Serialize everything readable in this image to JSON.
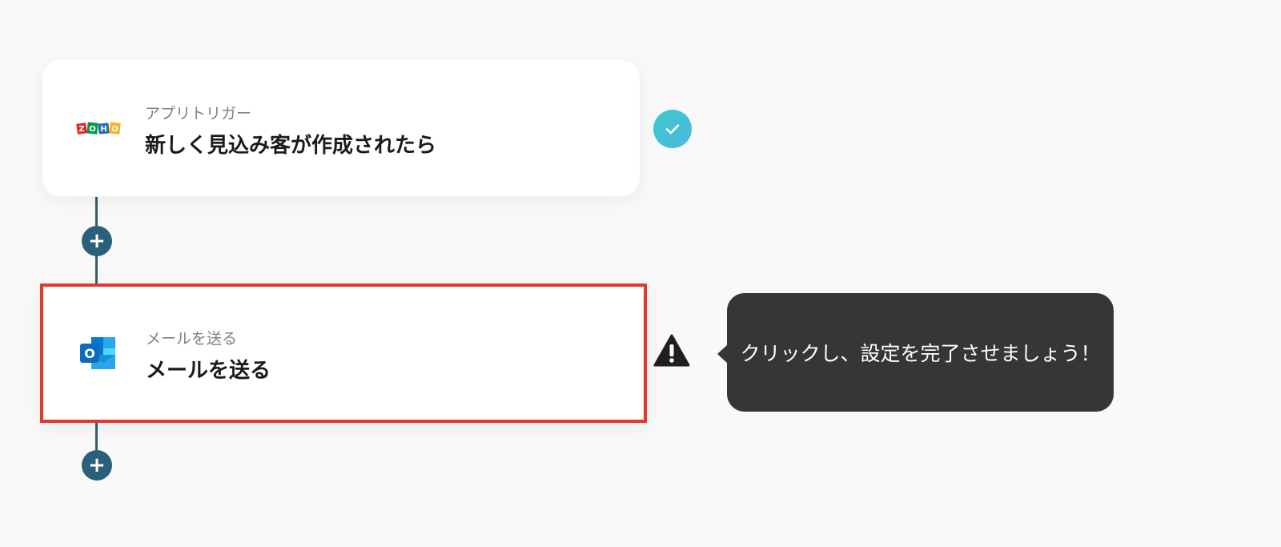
{
  "flow": {
    "steps": [
      {
        "type_label": "アプリトリガー",
        "title": "新しく見込み客が作成されたら",
        "app_icon": "zoho-logo-icon",
        "status": "complete",
        "status_icon": "check-icon"
      },
      {
        "type_label": "メールを送る",
        "title": "メールを送る",
        "app_icon": "outlook-logo-icon",
        "status": "incomplete",
        "status_icon": "warning-icon",
        "highlighted": true
      }
    ],
    "add_step_label": "+"
  },
  "tooltip": {
    "text": "クリックし、設定を完了させましょう！"
  },
  "colors": {
    "background": "#f9f9f9",
    "connector": "#2b6079",
    "highlight_border": "#e03a2a",
    "check_gradient_start": "#3cc9c9",
    "check_gradient_end": "#4ab8e0",
    "tooltip_bg": "#363636"
  }
}
